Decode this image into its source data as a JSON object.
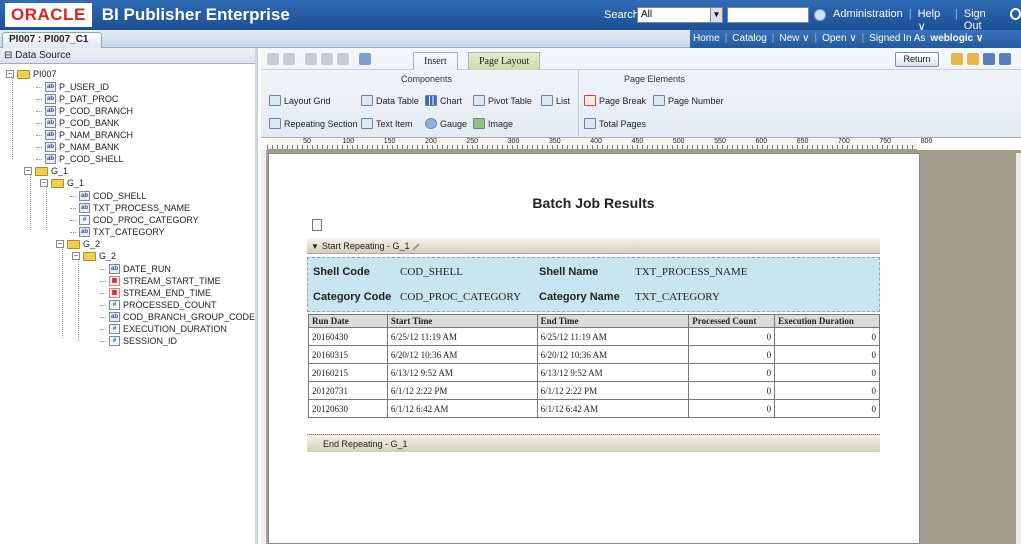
{
  "header": {
    "logo": "ORACLE",
    "product": "BI Publisher Enterprise",
    "search_label": "Search",
    "search_scope": "All",
    "nav": [
      "Administration",
      "Help ∨",
      "Sign Out"
    ]
  },
  "subheader": {
    "doc_tab": "PI007 : PI007_C1",
    "nav": {
      "home": "Home",
      "catalog": "Catalog",
      "new": "New ∨",
      "open": "Open ∨",
      "signed_in_prefix": "Signed In As",
      "user": "weblogic ∨"
    }
  },
  "datasource": {
    "title": "Data Source",
    "tree": [
      {
        "label": "PI007",
        "type": "folder"
      },
      {
        "label": "P_USER_ID",
        "type": "text"
      },
      {
        "label": "P_DAT_PROC",
        "type": "text"
      },
      {
        "label": "P_COD_BRANCH",
        "type": "text"
      },
      {
        "label": "P_COD_BANK",
        "type": "text"
      },
      {
        "label": "P_NAM_BRANCH",
        "type": "text"
      },
      {
        "label": "P_NAM_BANK",
        "type": "text"
      },
      {
        "label": "P_COD_SHELL",
        "type": "text"
      },
      {
        "label": "G_1",
        "type": "folder"
      },
      {
        "label": "G_1",
        "type": "folder"
      },
      {
        "label": "COD_SHELL",
        "type": "text"
      },
      {
        "label": "TXT_PROCESS_NAME",
        "type": "text"
      },
      {
        "label": "COD_PROC_CATEGORY",
        "type": "num"
      },
      {
        "label": "TXT_CATEGORY",
        "type": "text"
      },
      {
        "label": "G_2",
        "type": "folder"
      },
      {
        "label": "G_2",
        "type": "folder"
      },
      {
        "label": "DATE_RUN",
        "type": "text"
      },
      {
        "label": "STREAM_START_TIME",
        "type": "date"
      },
      {
        "label": "STREAM_END_TIME",
        "type": "date"
      },
      {
        "label": "PROCESSED_COUNT",
        "type": "num"
      },
      {
        "label": "COD_BRANCH_GROUP_CODE",
        "type": "text"
      },
      {
        "label": "EXECUTION_DURATION",
        "type": "num"
      },
      {
        "label": "SESSION_ID",
        "type": "num"
      }
    ]
  },
  "ribbon": {
    "tabs": [
      "Insert",
      "Page Layout"
    ],
    "return_label": "Return",
    "components_title": "Components",
    "page_elements_title": "Page Elements",
    "components": {
      "layout_grid": "Layout Grid",
      "data_table": "Data Table",
      "chart": "Chart",
      "pivot_table": "Pivot Table",
      "list": "List",
      "repeating_section": "Repeating Section",
      "text_item": "Text Item",
      "gauge": "Gauge",
      "image": "Image"
    },
    "page_elements": {
      "page_break": "Page Break",
      "page_number": "Page Number",
      "total_pages": "Total Pages"
    }
  },
  "ruler": [
    "50",
    "100",
    "150",
    "200",
    "250",
    "300",
    "350",
    "400",
    "450",
    "500",
    "550",
    "600",
    "650",
    "700",
    "750",
    "800"
  ],
  "report": {
    "title": "Batch Job Results",
    "repeat_start": "Start Repeating - G_1",
    "repeat_end": "End Repeating - G_1",
    "shell_code_label": "Shell Code",
    "shell_code_value": "COD_SHELL",
    "shell_name_label": "Shell Name",
    "shell_name_value": "TXT_PROCESS_NAME",
    "category_code_label": "Category Code",
    "category_code_value": "COD_PROC_CATEGORY",
    "category_name_label": "Category Name",
    "category_name_value": "TXT_CATEGORY",
    "columns": [
      "Run Date",
      "Start Time",
      "End Time",
      "Processed Count",
      "Execution Duration"
    ],
    "rows": [
      [
        "20160430",
        "6/25/12 11:19 AM",
        "6/25/12 11:19 AM",
        "0",
        "0"
      ],
      [
        "20160315",
        "6/20/12 10:36 AM",
        "6/20/12 10:36 AM",
        "0",
        "0"
      ],
      [
        "20160215",
        "6/13/12 9:52 AM",
        "6/13/12 9:52 AM",
        "0",
        "0"
      ],
      [
        "20120731",
        "6/1/12 2:22 PM",
        "6/1/12 2:22 PM",
        "0",
        "0"
      ],
      [
        "20120630",
        "6/1/12 6:42 AM",
        "6/1/12 6:42 AM",
        "0",
        "0"
      ]
    ]
  },
  "colors": {
    "header_blue": "#1c4f93",
    "oracle_red": "#d9231f",
    "info_band": "#c7e6ef",
    "canvas_bg": "#a39d8e"
  }
}
